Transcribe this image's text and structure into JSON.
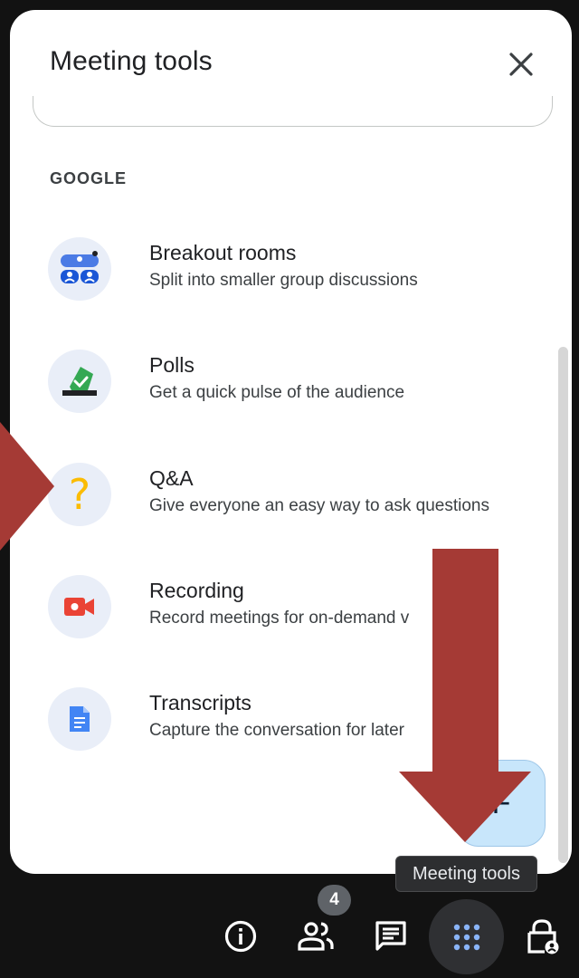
{
  "panel": {
    "title": "Meeting tools",
    "section_label": "GOOGLE",
    "tools": [
      {
        "title": "Breakout rooms",
        "description": "Split into smaller group discussions",
        "icon": "breakout-rooms-icon"
      },
      {
        "title": "Polls",
        "description": "Get a quick pulse of the audience",
        "icon": "polls-icon"
      },
      {
        "title": "Q&A",
        "description": "Give everyone an easy way to ask questions",
        "icon": "qa-icon"
      },
      {
        "title": "Recording",
        "description": "Record meetings for on-demand v",
        "icon": "recording-icon"
      },
      {
        "title": "Transcripts",
        "description": "Capture the conversation for later",
        "icon": "transcripts-icon"
      }
    ]
  },
  "toolbar": {
    "tooltip": "Meeting tools",
    "people_count": "4",
    "buttons": [
      "info-icon",
      "people-icon",
      "chat-icon",
      "meeting-tools-icon",
      "host-controls-icon"
    ]
  },
  "colors": {
    "panel_bg": "#ffffff",
    "screen_bg": "#121212",
    "annotation_arrow": "#a53a35",
    "fab_bg": "#c8e6fb"
  }
}
